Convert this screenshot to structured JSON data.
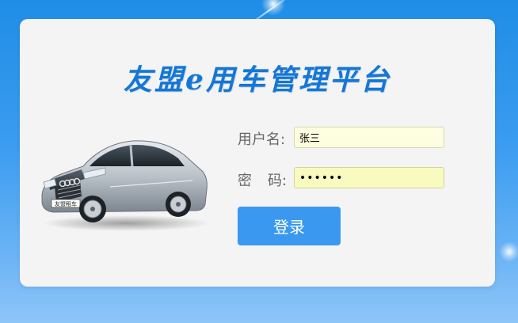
{
  "app": {
    "title": "友盟e用车管理平台"
  },
  "login_form": {
    "username_label": "用户名:",
    "username_value": "张三",
    "password_label_left": "密",
    "password_label_right": "码:",
    "password_value": "123456",
    "submit_label": "登录"
  },
  "car_image": {
    "plate_text": "友盟租车"
  },
  "colors": {
    "background": "#2a93ea",
    "card": "#f4f4f4",
    "title": "#1477d6",
    "button": "#3a98f0",
    "input_bg": "#fdfde0"
  }
}
